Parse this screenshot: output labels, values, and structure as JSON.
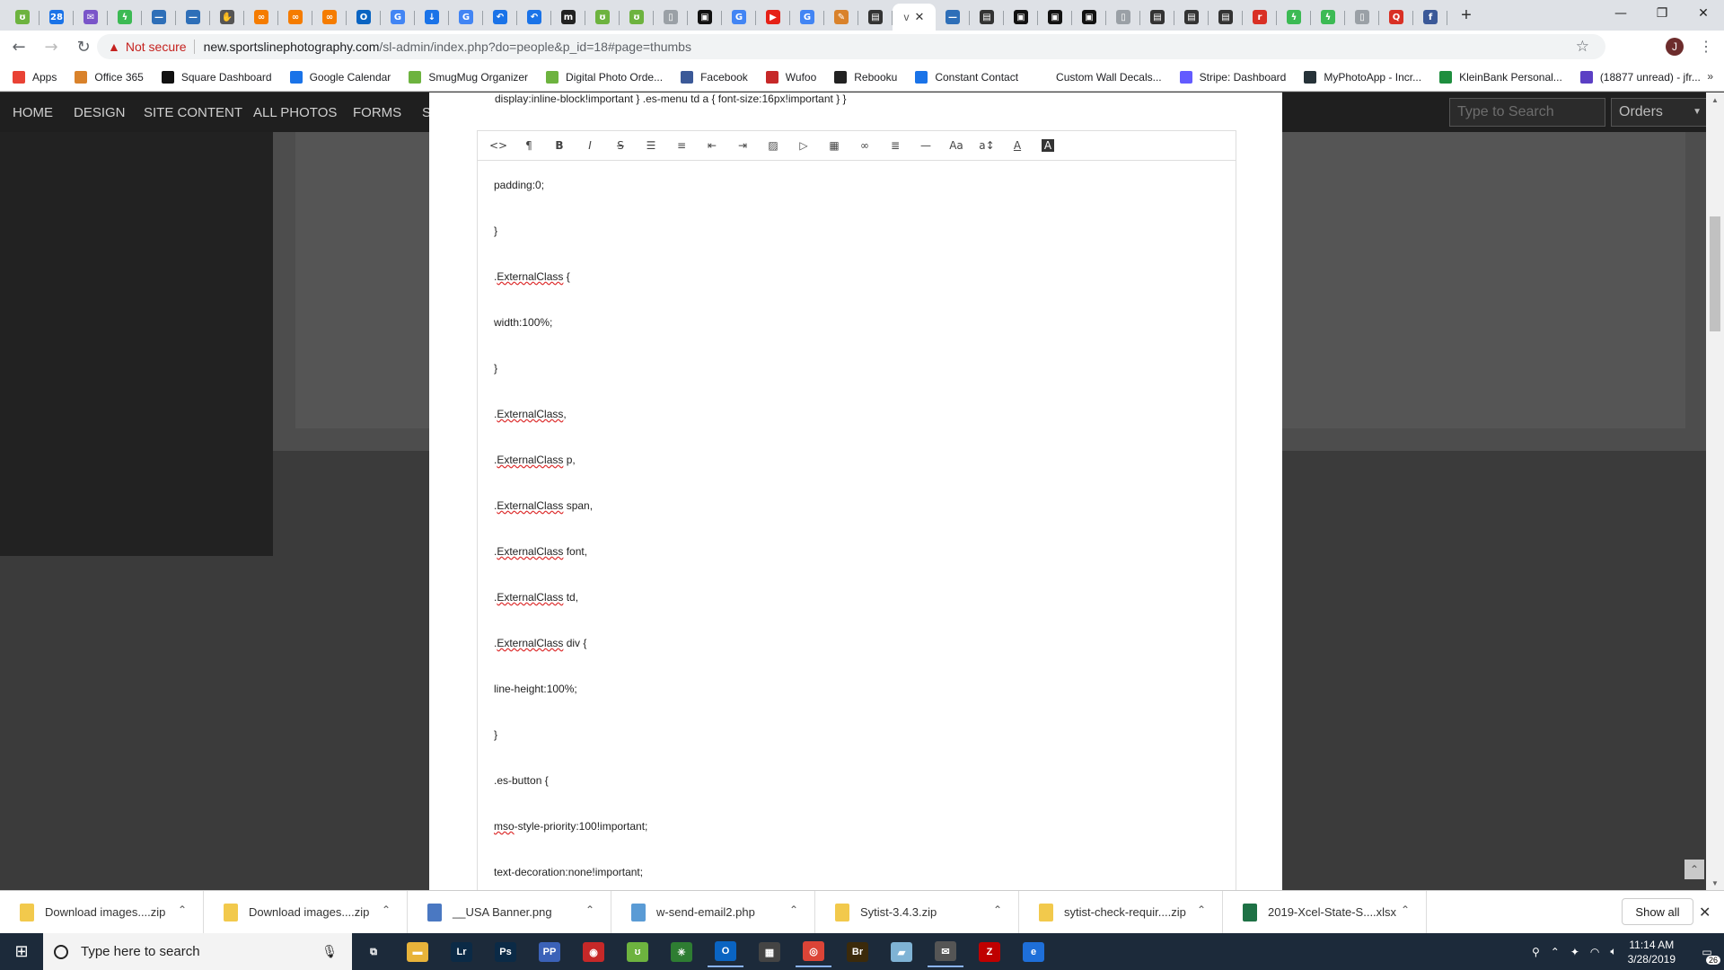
{
  "browser": {
    "tabs": [
      {
        "icon": "smugmug-icon",
        "color": "#6db33f",
        "glyph": "ʊ"
      },
      {
        "icon": "calendar-icon",
        "color": "#1a73e8",
        "glyph": "28"
      },
      {
        "icon": "mail-icon",
        "color": "#7a55c9",
        "glyph": "✉"
      },
      {
        "icon": "leaf-icon",
        "color": "#3cba54",
        "glyph": "ϟ"
      },
      {
        "icon": "bank-icon",
        "color": "#2e6fb8",
        "glyph": "—"
      },
      {
        "icon": "bank-icon",
        "color": "#2e6fb8",
        "glyph": "—"
      },
      {
        "icon": "hand-icon",
        "color": "#555",
        "glyph": "✋"
      },
      {
        "icon": "link-icon",
        "color": "#f57c00",
        "glyph": "∞"
      },
      {
        "icon": "link-icon",
        "color": "#f57c00",
        "glyph": "∞"
      },
      {
        "icon": "link-icon",
        "color": "#f57c00",
        "glyph": "∞"
      },
      {
        "icon": "outlook-icon",
        "color": "#0a64c2",
        "glyph": "O"
      },
      {
        "icon": "google-icon",
        "color": "#4285f4",
        "glyph": "G"
      },
      {
        "icon": "download-icon",
        "color": "#1a73e8",
        "glyph": "↓"
      },
      {
        "icon": "google-icon",
        "color": "#4285f4",
        "glyph": "G"
      },
      {
        "icon": "back-arrow-icon",
        "color": "#1a73e8",
        "glyph": "↶"
      },
      {
        "icon": "back-arrow-icon",
        "color": "#1a73e8",
        "glyph": "↶"
      },
      {
        "icon": "m-icon",
        "color": "#222",
        "glyph": "m"
      },
      {
        "icon": "smugmug-icon",
        "color": "#6db33f",
        "glyph": "ʊ"
      },
      {
        "icon": "smugmug-icon",
        "color": "#6db33f",
        "glyph": "ʊ"
      },
      {
        "icon": "page-icon",
        "color": "#9aa0a6",
        "glyph": "▯"
      },
      {
        "icon": "square-icon",
        "color": "#111",
        "glyph": "▣"
      },
      {
        "icon": "google-icon",
        "color": "#4285f4",
        "glyph": "G"
      },
      {
        "icon": "youtube-icon",
        "color": "#e62117",
        "glyph": "▶"
      },
      {
        "icon": "google-icon",
        "color": "#4285f4",
        "glyph": "G"
      },
      {
        "icon": "paint-icon",
        "color": "#d9822b",
        "glyph": "✎"
      },
      {
        "icon": "window-icon",
        "color": "#333",
        "glyph": "▤"
      }
    ],
    "tabs_after": [
      {
        "icon": "bank-icon",
        "color": "#2e6fb8",
        "glyph": "—"
      },
      {
        "icon": "window-icon",
        "color": "#333",
        "glyph": "▤"
      },
      {
        "icon": "square-icon",
        "color": "#111",
        "glyph": "▣"
      },
      {
        "icon": "square-icon",
        "color": "#111",
        "glyph": "▣"
      },
      {
        "icon": "square-icon",
        "color": "#111",
        "glyph": "▣"
      },
      {
        "icon": "page-icon",
        "color": "#9aa0a6",
        "glyph": "▯"
      },
      {
        "icon": "window-icon",
        "color": "#333",
        "glyph": "▤"
      },
      {
        "icon": "window-icon",
        "color": "#333",
        "glyph": "▤"
      },
      {
        "icon": "window-icon",
        "color": "#333",
        "glyph": "▤"
      },
      {
        "icon": "red-label-icon",
        "color": "#d93025",
        "glyph": "r"
      },
      {
        "icon": "leaf-icon",
        "color": "#3cba54",
        "glyph": "ϟ"
      },
      {
        "icon": "leaf-icon",
        "color": "#3cba54",
        "glyph": "ϟ"
      },
      {
        "icon": "page-icon",
        "color": "#9aa0a6",
        "glyph": "▯"
      },
      {
        "icon": "q-icon",
        "color": "#d93025",
        "glyph": "Q"
      },
      {
        "icon": "facebook-icon",
        "color": "#3b5998",
        "glyph": "f"
      }
    ],
    "active_tab_letter": "v",
    "address": {
      "warning": "Not secure",
      "host": "new.sportslinephotography.com",
      "path": "/sl-admin/index.php?do=people&p_id=18#page=thumbs"
    },
    "profile_initial": "J"
  },
  "bookmarks": [
    {
      "label": "Apps",
      "icon": "apps-icon",
      "color": "#e94235"
    },
    {
      "label": "Office 365",
      "icon": "office-icon",
      "color": "#d9822b"
    },
    {
      "label": "Square Dashboard",
      "icon": "square-icon",
      "color": "#111"
    },
    {
      "label": "Google Calendar",
      "icon": "calendar-icon",
      "color": "#1a73e8"
    },
    {
      "label": "SmugMug Organizer",
      "icon": "smugmug-icon",
      "color": "#6db33f"
    },
    {
      "label": "Digital Photo Orde...",
      "icon": "smugmug-icon",
      "color": "#6db33f"
    },
    {
      "label": "Facebook",
      "icon": "facebook-icon",
      "color": "#3b5998"
    },
    {
      "label": "Wufoo",
      "icon": "wufoo-icon",
      "color": "#c62828"
    },
    {
      "label": "Rebooku",
      "icon": "rebooku-icon",
      "color": "#222"
    },
    {
      "label": "Constant Contact",
      "icon": "constant-contact-icon",
      "color": "#1a73e8"
    },
    {
      "label": "Custom Wall Decals...",
      "icon": "blank-icon",
      "color": "#fff"
    },
    {
      "label": "Stripe: Dashboard",
      "icon": "stripe-icon",
      "color": "#635bff"
    },
    {
      "label": "MyPhotoApp - Incr...",
      "icon": "myphotoapp-icon",
      "color": "#263238"
    },
    {
      "label": "KleinBank  Personal...",
      "icon": "kleinbank-icon",
      "color": "#1e8e3e"
    },
    {
      "label": "(18877 unread) - jfr...",
      "icon": "mail-icon",
      "color": "#5b3fc4"
    }
  ],
  "site_nav": {
    "items": [
      "HOME",
      "DESIGN",
      "SITE CONTENT",
      "ALL PHOTOS",
      "FORMS",
      "S"
    ],
    "search_placeholder": "Type to Search",
    "orders_label": "Orders"
  },
  "editor": {
    "top_line": "display:inline-block!important } .es-menu td a { font-size:16px!important } }",
    "toolbar": [
      {
        "name": "html-icon",
        "glyph": "<>"
      },
      {
        "name": "paragraph-icon",
        "glyph": "¶"
      },
      {
        "name": "bold-icon",
        "glyph": "B"
      },
      {
        "name": "italic-icon",
        "glyph": "I"
      },
      {
        "name": "strikethrough-icon",
        "glyph": "S̶"
      },
      {
        "name": "unordered-list-icon",
        "glyph": "☰"
      },
      {
        "name": "ordered-list-icon",
        "glyph": "≡"
      },
      {
        "name": "outdent-icon",
        "glyph": "⇤"
      },
      {
        "name": "indent-icon",
        "glyph": "⇥"
      },
      {
        "name": "image-icon",
        "glyph": "▨"
      },
      {
        "name": "video-icon",
        "glyph": "▷"
      },
      {
        "name": "table-icon",
        "glyph": "▦"
      },
      {
        "name": "link-icon",
        "glyph": "∞"
      },
      {
        "name": "align-icon",
        "glyph": "≣"
      },
      {
        "name": "horizontal-rule-icon",
        "glyph": "—"
      },
      {
        "name": "font-size-icon",
        "glyph": "Aa"
      },
      {
        "name": "line-height-icon",
        "glyph": "a↕"
      },
      {
        "name": "font-color-icon",
        "glyph": "A"
      },
      {
        "name": "background-color-icon",
        "glyph": "A"
      }
    ],
    "lines": [
      {
        "pre": "padding:0;",
        "sq": "",
        "post": ""
      },
      {
        "pre": "}",
        "sq": "",
        "post": ""
      },
      {
        "pre": ".",
        "sq": "ExternalClass",
        "post": " {"
      },
      {
        "pre": "width:100%;",
        "sq": "",
        "post": ""
      },
      {
        "pre": "}",
        "sq": "",
        "post": ""
      },
      {
        "pre": ".",
        "sq": "ExternalClass",
        "post": ","
      },
      {
        "pre": ".",
        "sq": "ExternalClass",
        "post": " p,"
      },
      {
        "pre": ".",
        "sq": "ExternalClass",
        "post": " span,"
      },
      {
        "pre": ".",
        "sq": "ExternalClass",
        "post": " font,"
      },
      {
        "pre": ".",
        "sq": "ExternalClass",
        "post": " td,"
      },
      {
        "pre": ".",
        "sq": "ExternalClass",
        "post": " div {"
      },
      {
        "pre": "line-height:100%;",
        "sq": "",
        "post": ""
      },
      {
        "pre": "}",
        "sq": "",
        "post": ""
      },
      {
        "pre": ".es-button {",
        "sq": "",
        "post": ""
      },
      {
        "pre": "",
        "sq": "mso",
        "post": "-style-priority:100!important;"
      },
      {
        "pre": "text-decoration:none!important;",
        "sq": "",
        "post": ""
      }
    ]
  },
  "downloads": [
    {
      "label": "Download images....zip",
      "color": "#f2c94c"
    },
    {
      "label": "Download images....zip",
      "color": "#f2c94c"
    },
    {
      "label": "__USA Banner.png",
      "color": "#4a78c2"
    },
    {
      "label": "w-send-email2.php",
      "color": "#5a9bd5"
    },
    {
      "label": "Sytist-3.4.3.zip",
      "color": "#f2c94c"
    },
    {
      "label": "sytist-check-requir....zip",
      "color": "#f2c94c"
    },
    {
      "label": "2019-Xcel-State-S....xlsx",
      "color": "#1e7145"
    }
  ],
  "show_all_label": "Show all",
  "taskbar": {
    "search_placeholder": "Type here to search",
    "apps": [
      {
        "name": "task-view-icon",
        "color": "#1c2a3a",
        "glyph": "⧉",
        "running": false
      },
      {
        "name": "file-explorer-icon",
        "color": "#e8b33a",
        "glyph": "▬",
        "running": false
      },
      {
        "name": "lightroom-icon",
        "color": "#0b2a46",
        "glyph": "Lr",
        "running": false
      },
      {
        "name": "photoshop-icon",
        "color": "#0b2a46",
        "glyph": "Ps",
        "running": false
      },
      {
        "name": "photo-app-icon",
        "color": "#3b62b8",
        "glyph": "PP",
        "running": false
      },
      {
        "name": "red-app-icon",
        "color": "#c62828",
        "glyph": "◉",
        "running": false
      },
      {
        "name": "smugmug-app-icon",
        "color": "#6db33f",
        "glyph": "ʊ",
        "running": false
      },
      {
        "name": "green-app-icon",
        "color": "#2e7d32",
        "glyph": "✳",
        "running": false
      },
      {
        "name": "outlook-app-icon",
        "color": "#0a64c2",
        "glyph": "O",
        "running": true
      },
      {
        "name": "calculator-icon",
        "color": "#444",
        "glyph": "▦",
        "running": false
      },
      {
        "name": "chrome-icon",
        "color": "#db4437",
        "glyph": "◎",
        "running": true
      },
      {
        "name": "bridge-icon",
        "color": "#3b2a0b",
        "glyph": "Br",
        "running": false
      },
      {
        "name": "tablet-app-icon",
        "color": "#7fb3d5",
        "glyph": "▰",
        "running": false
      },
      {
        "name": "mail-app-icon",
        "color": "#555",
        "glyph": "✉",
        "running": true
      },
      {
        "name": "filezilla-icon",
        "color": "#bf0000",
        "glyph": "Z",
        "running": false
      },
      {
        "name": "edge-icon",
        "color": "#1e6fd9",
        "glyph": "e",
        "running": false
      }
    ],
    "time": "11:14 AM",
    "date": "3/28/2019",
    "notifications": "26"
  }
}
